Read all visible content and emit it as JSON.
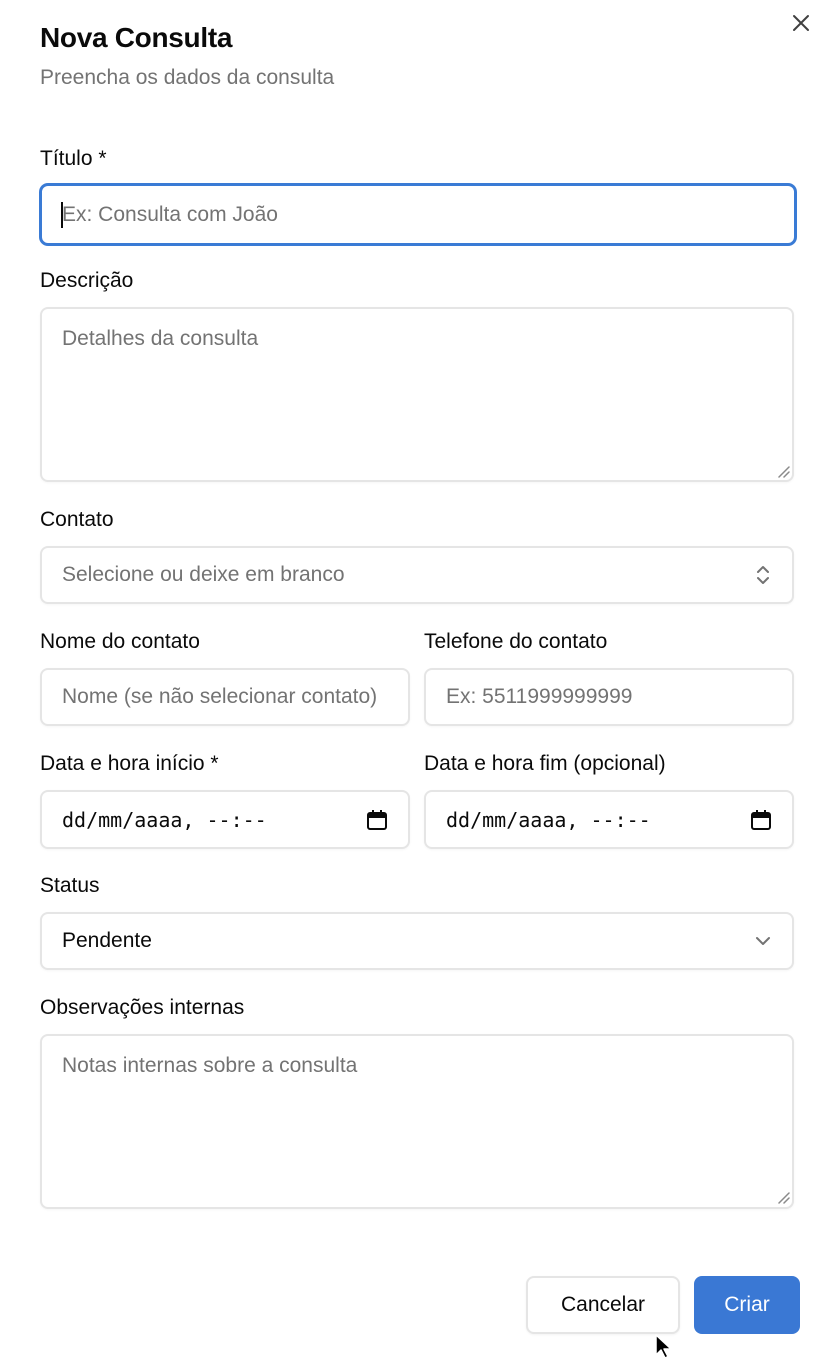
{
  "dialog": {
    "title": "Nova Consulta",
    "subtitle": "Preencha os dados da consulta"
  },
  "fields": {
    "titulo": {
      "label": "Título *",
      "placeholder": "Ex: Consulta com João",
      "value": ""
    },
    "descricao": {
      "label": "Descrição",
      "placeholder": "Detalhes da consulta",
      "value": ""
    },
    "contato": {
      "label": "Contato",
      "placeholder": "Selecione ou deixe em branco"
    },
    "nome_contato": {
      "label": "Nome do contato",
      "placeholder": "Nome (se não selecionar contato)"
    },
    "telefone_contato": {
      "label": "Telefone do contato",
      "placeholder": "Ex: 5511999999999"
    },
    "data_inicio": {
      "label": "Data e hora início *",
      "placeholder": "dd/mm/aaaa, --:--"
    },
    "data_fim": {
      "label": "Data e hora fim (opcional)",
      "placeholder": "dd/mm/aaaa, --:--"
    },
    "status": {
      "label": "Status",
      "value": "Pendente"
    },
    "observacoes": {
      "label": "Observações internas",
      "placeholder": "Notas internas sobre a consulta",
      "value": ""
    }
  },
  "actions": {
    "cancel_label": "Cancelar",
    "create_label": "Criar"
  },
  "colors": {
    "primary": "#3a78d4",
    "focus_ring": "#3a7bd5",
    "border": "#e5e5e5",
    "muted_text": "#737373"
  },
  "icons": {
    "close": "close-icon",
    "combobox": "chevrons-up-down-icon",
    "calendar": "calendar-icon",
    "select": "chevron-down-icon",
    "cursor": "mouse-pointer-icon"
  }
}
